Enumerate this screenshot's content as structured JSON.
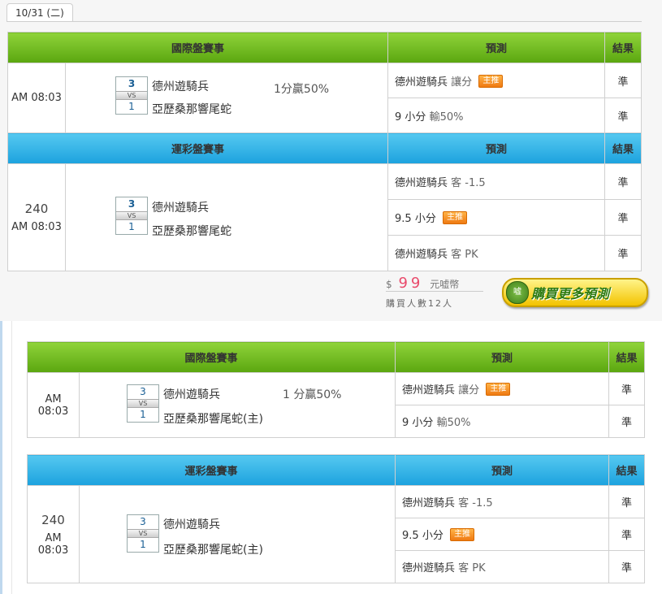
{
  "date_tab": "10/31 (二)",
  "top": {
    "intl": {
      "header": {
        "event": "國際盤賽事",
        "prediction": "預測",
        "result": "結果"
      },
      "time": "AM 08:03",
      "score_home": "3",
      "vs": "VS",
      "score_away": "1",
      "team_a": "德州遊騎兵",
      "team_b": "亞歷桑那響尾蛇",
      "handicap": "1分贏50%",
      "rows": [
        {
          "team": "德州遊騎兵",
          "pick": "讓分",
          "tag": "主推",
          "result": "準"
        },
        {
          "team": "9 小分",
          "pick": "輸50%",
          "result": "準"
        }
      ]
    },
    "lottery": {
      "header": {
        "event": "運彩盤賽事",
        "prediction": "預測",
        "result": "結果"
      },
      "num": "240",
      "time": "AM 08:03",
      "score_home": "3",
      "vs": "VS",
      "score_away": "1",
      "team_a": "德州遊騎兵",
      "team_b": "亞歷桑那響尾蛇",
      "rows": [
        {
          "team": "德州遊騎兵",
          "pick": "客 -1.5",
          "result": "準"
        },
        {
          "team": "9.5 小分",
          "tag": "主推",
          "result": "準"
        },
        {
          "team": "德州遊騎兵",
          "pick": "客 PK",
          "result": "準"
        }
      ]
    },
    "price": {
      "symbol": "$",
      "amount": "99",
      "unit": "元嘘幣",
      "buyers": "購買人數12人",
      "button": "購買更多預測",
      "coin": "嘘"
    }
  },
  "bottom": {
    "intl": {
      "header": {
        "event": "國際盤賽事",
        "prediction": "預測",
        "result": "結果"
      },
      "time": "AM 08:03",
      "score_home": "3",
      "vs": "VS",
      "score_away": "1",
      "team_a": "德州遊騎兵",
      "team_b": "亞歷桑那響尾蛇(主)",
      "handicap": "1 分贏50%",
      "rows": [
        {
          "team": "德州遊騎兵",
          "pick": "讓分",
          "tag": "主推",
          "result": "準"
        },
        {
          "team": "9 小分",
          "pick": "輸50%",
          "result": "準"
        }
      ]
    },
    "lottery": {
      "header": {
        "event": "運彩盤賽事",
        "prediction": "預測",
        "result": "結果"
      },
      "num": "240",
      "time": "AM 08:03",
      "score_home": "3",
      "vs": "VS",
      "score_away": "1",
      "team_a": "德州遊騎兵",
      "team_b": "亞歷桑那響尾蛇(主)",
      "rows": [
        {
          "team": "德州遊騎兵",
          "pick": "客 -1.5",
          "result": "準"
        },
        {
          "team": "9.5 小分",
          "tag": "主推",
          "result": "準"
        },
        {
          "team": "德州遊騎兵",
          "pick": "客 PK",
          "result": "準"
        }
      ]
    }
  }
}
